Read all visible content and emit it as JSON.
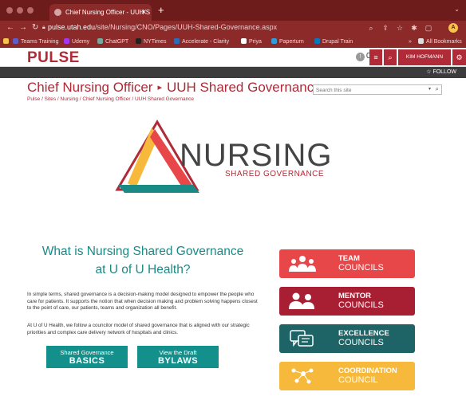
{
  "browser": {
    "tab_title": "Chief Nursing Officer - UUH S",
    "tab_close": "✕",
    "new_tab": "+",
    "url_host": "pulse.utah.edu",
    "url_path": "/site/Nursing/CNO/Pages/UUH-Shared-Governance.aspx",
    "bookmarks": [
      "Teams Training",
      "Udemy",
      "ChatGPT",
      "NYTimes",
      "Accelerate - Clarity",
      "Priya",
      "Paperturn",
      "Drupal Train"
    ],
    "bookmarks_overflow": "»",
    "all_bookmarks": "All Bookmarks",
    "profile_initial": "A"
  },
  "header": {
    "logo": "PULSE",
    "notifications": "0",
    "user": "KIM HOFMANN",
    "follow": "FOLLOW"
  },
  "page": {
    "site_title": "Chief Nursing Officer",
    "title_sep": "▸",
    "subsite_title": "UUH Shared Governance",
    "breadcrumb": "Pulse / Sites / Nursing / Chief Nursing Officer / UUH Shared Governance",
    "search_placeholder": "Search this site"
  },
  "logo": {
    "word": "NURSING",
    "sub": "SHARED GOVERNANCE"
  },
  "intro": {
    "heading_line1": "What is Nursing Shared Governance",
    "heading_line2": "at U of U Health?",
    "para1": "In simple terms, shared governance is a decision-making model designed to empower the people who care for patients. It supports the notion that when decision making and problem solving happens closest to the point of care, our patients, teams and organization all benefit.",
    "para2": "At U of U Health, we follow a councilor model of shared governance that is aligned with our strategic priorities and complex care delivery network of hospitals and clinics."
  },
  "buttons": {
    "basics_line1": "Shared Governance",
    "basics_line2": "BASICS",
    "bylaws_line1": "View the Draft",
    "bylaws_line2": "BYLAWS"
  },
  "councils": [
    {
      "title": "TEAM",
      "sub": "COUNCILS",
      "color": "#e8474a",
      "icon": "team-icon"
    },
    {
      "title": "MENTOR",
      "sub": "COUNCILS",
      "color": "#a81f33",
      "icon": "mentor-icon"
    },
    {
      "title": "EXCELLENCE",
      "sub": "COUNCILS",
      "color": "#1e6466",
      "icon": "excellence-icon"
    },
    {
      "title": "COORDINATION",
      "sub": "COUNCIL",
      "color": "#f6b93b",
      "icon": "coordination-icon"
    }
  ],
  "colors": {
    "brand_red": "#b02a37",
    "teal": "#14908c",
    "browser_chrome": "#8c2a2a"
  }
}
